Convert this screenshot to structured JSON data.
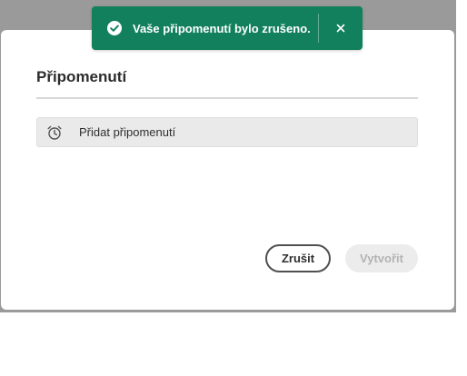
{
  "toast": {
    "message": "Vaše připomenutí bylo zrušeno.",
    "icon": "checkmark-circle-icon",
    "close_icon": "close-icon",
    "color": "#12805c"
  },
  "dialog": {
    "title": "Připomenutí",
    "add_reminder_label": "Přidat připomenutí",
    "add_reminder_icon": "alarm-clock-icon",
    "cancel_label": "Zrušit",
    "create_label": "Vytvořit"
  }
}
